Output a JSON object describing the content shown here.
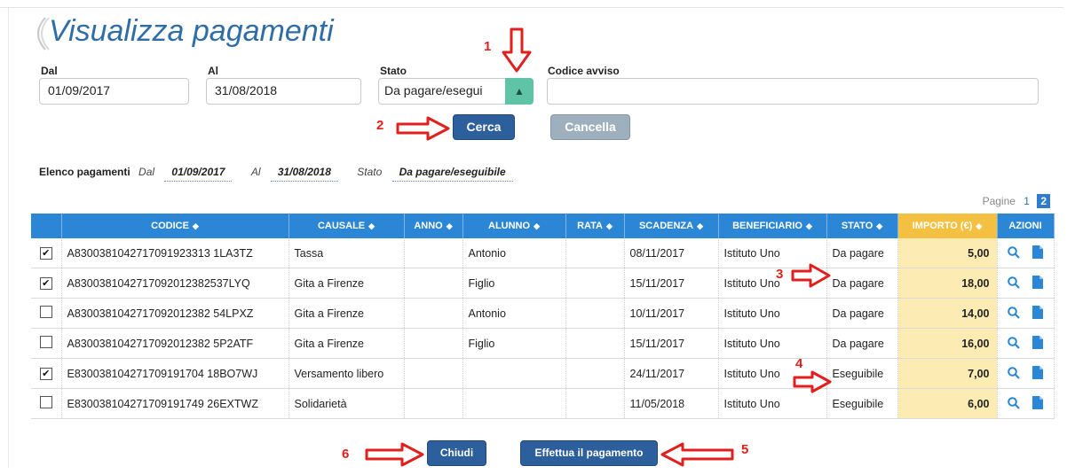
{
  "page": {
    "title": "Visualizza pagamenti"
  },
  "filters": {
    "dal_label": "Dal",
    "dal_value": "01/09/2017",
    "al_label": "Al",
    "al_value": "31/08/2018",
    "stato_label": "Stato",
    "stato_value": "Da pagare/esegui",
    "codice_label": "Codice avviso",
    "codice_value": ""
  },
  "buttons": {
    "cerca": "Cerca",
    "cancella": "Cancella",
    "chiudi": "Chiudi",
    "effettua": "Effettua il pagamento"
  },
  "summary": {
    "label": "Elenco pagamenti",
    "dal_label": "Dal",
    "dal": "01/09/2017",
    "al_label": "Al",
    "al": "31/08/2018",
    "stato_label": "Stato",
    "stato": "Da pagare/eseguibile"
  },
  "pagination": {
    "label": "Pagine",
    "page1": "1",
    "page2": "2"
  },
  "table": {
    "headers": [
      "CODICE",
      "CAUSALE",
      "ANNO",
      "ALUNNO",
      "RATA",
      "SCADENZA",
      "BENEFICIARIO",
      "STATO",
      "IMPORTO (€)",
      "AZIONI"
    ],
    "rows": [
      {
        "checked": true,
        "codice": "A8300381042717091923313 1LA3TZ",
        "causale": "Tassa",
        "anno": "",
        "alunno": "Antonio",
        "rata": "",
        "scadenza": "08/11/2017",
        "beneficiario": "Istituto Uno",
        "stato": "Da pagare",
        "importo": "5,00"
      },
      {
        "checked": true,
        "codice": "A8300381042717092012382537LYQ",
        "causale": "Gita a Firenze",
        "anno": "",
        "alunno": "Figlio",
        "rata": "",
        "scadenza": "15/11/2017",
        "beneficiario": "Istituto Uno",
        "stato": "Da pagare",
        "importo": "18,00"
      },
      {
        "checked": false,
        "codice": "A8300381042717092012382 54LPXZ",
        "causale": "Gita a Firenze",
        "anno": "",
        "alunno": "Antonio",
        "rata": "",
        "scadenza": "10/11/2017",
        "beneficiario": "Istituto Uno",
        "stato": "Da pagare",
        "importo": "14,00"
      },
      {
        "checked": false,
        "codice": "A8300381042717092012382 5P2ATF",
        "causale": "Gita a Firenze",
        "anno": "",
        "alunno": "Figlio",
        "rata": "",
        "scadenza": "15/11/2017",
        "beneficiario": "Istituto Uno",
        "stato": "Da pagare",
        "importo": "16,00"
      },
      {
        "checked": true,
        "codice": "E830038104271709191704 18BO7WJ",
        "causale": "Versamento libero",
        "anno": "",
        "alunno": "",
        "rata": "",
        "scadenza": "24/11/2017",
        "beneficiario": "Istituto Uno",
        "stato": "Eseguibile",
        "importo": "7,00"
      },
      {
        "checked": false,
        "codice": "E830038104271709191749 26EXTWZ",
        "causale": "Solidarietà",
        "anno": "",
        "alunno": "",
        "rata": "",
        "scadenza": "11/05/2018",
        "beneficiario": "Istituto Uno",
        "stato": "Eseguibile",
        "importo": "6,00"
      }
    ]
  },
  "annotations": {
    "n1": "1",
    "n2": "2",
    "n3": "3",
    "n4": "4",
    "n5": "5",
    "n6": "6"
  },
  "colors": {
    "accent": "#2b87d6",
    "primary_button": "#2c5f9b",
    "annotation": "#e0201d",
    "importo_header": "#f3c041",
    "importo_cell": "#fcecb4",
    "select_button": "#5fc4a5"
  }
}
